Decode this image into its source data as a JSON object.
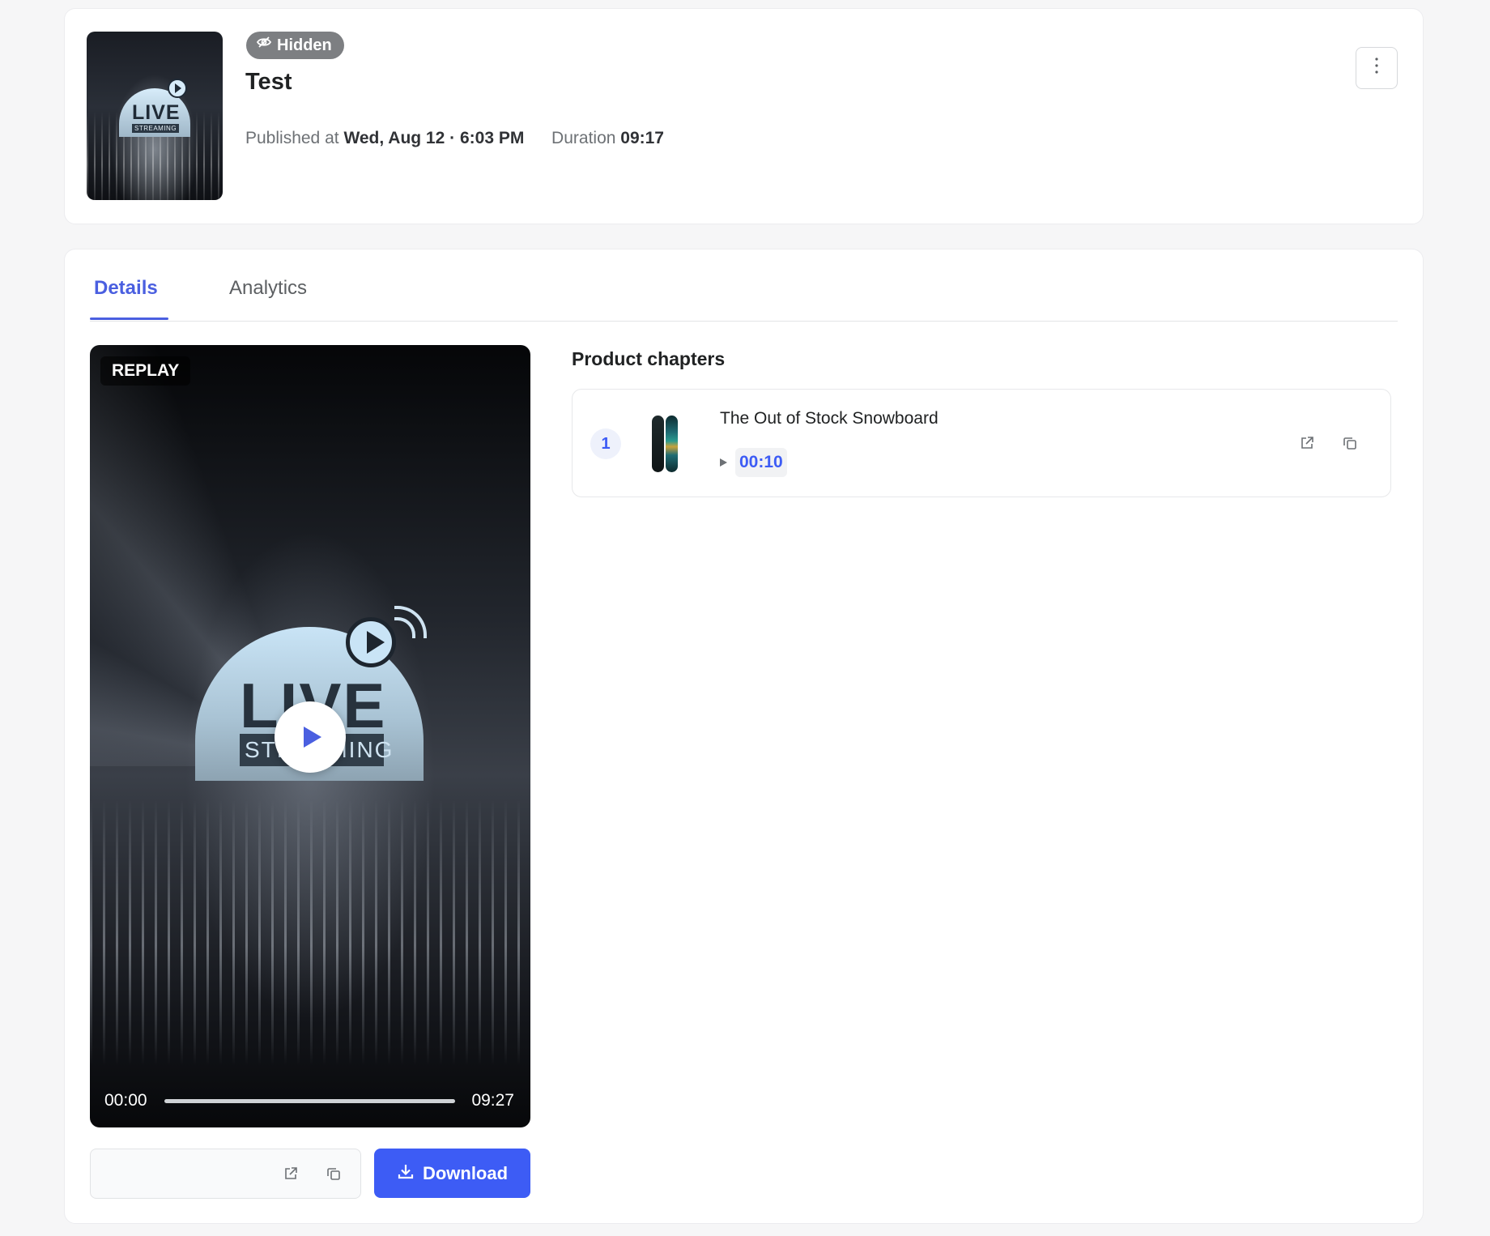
{
  "header": {
    "status_badge": "Hidden",
    "title": "Test",
    "published_label": "Published at",
    "published_date": "Wed, Aug 12",
    "published_sep": "·",
    "published_time": "6:03 PM",
    "duration_label": "Duration",
    "duration_value": "09:17",
    "more_icon": "more-vertical-icon"
  },
  "thumbnail": {
    "live_text": "LIVE",
    "streaming_text": "STREAMING"
  },
  "tabs": [
    {
      "label": "Details",
      "active": true
    },
    {
      "label": "Analytics",
      "active": false
    }
  ],
  "video": {
    "badge": "REPLAY",
    "live_text": "LIVE",
    "streaming_text": "STREAMING",
    "current_time": "00:00",
    "total_time": "09:27",
    "progress": 0
  },
  "link_box": {
    "open_icon": "external-link-icon",
    "copy_icon": "copy-icon"
  },
  "download": {
    "label": "Download",
    "icon": "download-icon"
  },
  "product_chapters": {
    "title": "Product chapters",
    "items": [
      {
        "number": "1",
        "name": "The Out of Stock Snowboard",
        "time": "00:10"
      }
    ]
  },
  "colors": {
    "accent": "#3d5cf5",
    "tab_active": "#4a5fe0",
    "badge_hidden": "#7d7f82",
    "background": "#f6f6f7"
  }
}
